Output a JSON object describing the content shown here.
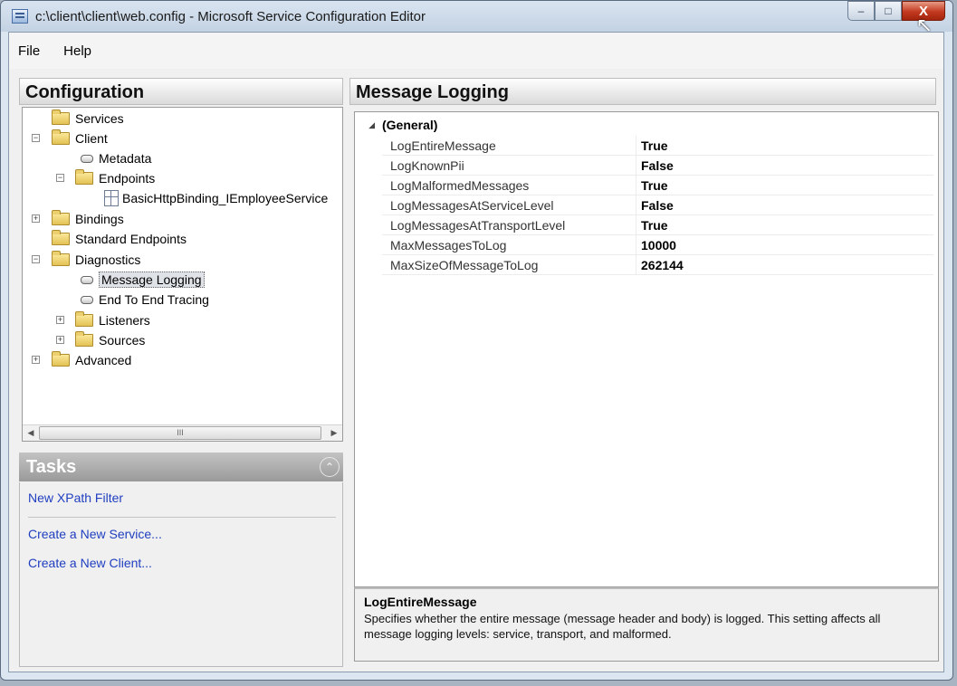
{
  "window": {
    "title": "c:\\client\\client\\web.config - Microsoft Service Configuration Editor",
    "min_glyph": "–",
    "max_glyph": "□",
    "close_glyph": "X"
  },
  "menu": {
    "items": [
      "File",
      "Help"
    ]
  },
  "config_panel": {
    "title": "Configuration",
    "tree": [
      {
        "label": "Services",
        "icon": "folder-icon"
      },
      {
        "label": "Client",
        "icon": "folder-icon",
        "expanded": true
      },
      {
        "label": "Metadata",
        "icon": "leaf-node-icon"
      },
      {
        "label": "Endpoints",
        "icon": "folder-icon",
        "expanded": true
      },
      {
        "label": "BasicHttpBinding_IEmployeeService",
        "icon": "endpoint-icon"
      },
      {
        "label": "Bindings",
        "icon": "folder-icon",
        "expanded": false
      },
      {
        "label": "Standard Endpoints",
        "icon": "folder-icon"
      },
      {
        "label": "Diagnostics",
        "icon": "folder-icon",
        "expanded": true
      },
      {
        "label": "Message Logging",
        "icon": "leaf-node-icon",
        "selected": true
      },
      {
        "label": "End To End Tracing",
        "icon": "leaf-node-icon"
      },
      {
        "label": "Listeners",
        "icon": "folder-icon",
        "expanded": false
      },
      {
        "label": "Sources",
        "icon": "folder-icon",
        "expanded": false
      },
      {
        "label": "Advanced",
        "icon": "folder-icon",
        "expanded": false
      }
    ],
    "scroll_thumb_glyph": "III"
  },
  "tasks_panel": {
    "title": "Tasks",
    "links": [
      "New XPath Filter",
      "Create a New Service...",
      "Create a New Client..."
    ]
  },
  "properties_panel": {
    "title": "Message Logging",
    "category": "(General)",
    "rows": [
      {
        "name": "LogEntireMessage",
        "value": "True"
      },
      {
        "name": "LogKnownPii",
        "value": "False"
      },
      {
        "name": "LogMalformedMessages",
        "value": "True"
      },
      {
        "name": "LogMessagesAtServiceLevel",
        "value": "False"
      },
      {
        "name": "LogMessagesAtTransportLevel",
        "value": "True"
      },
      {
        "name": "MaxMessagesToLog",
        "value": "10000"
      },
      {
        "name": "MaxSizeOfMessageToLog",
        "value": "262144"
      }
    ],
    "description_title": "LogEntireMessage",
    "description_text": "Specifies whether the entire message (message header and body) is logged. This setting affects all message logging levels: service, transport, and malformed."
  }
}
